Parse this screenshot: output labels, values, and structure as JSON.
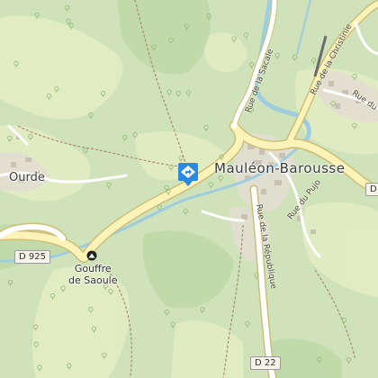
{
  "map": {
    "places": {
      "town": "Mauléon-Barousse",
      "village": "Ourde"
    },
    "poi": {
      "cave_name_line1": "Gouffre",
      "cave_name_line2": "de Saoule"
    },
    "road_shields": {
      "left": "D 925",
      "bottom": "D 22",
      "right": "D"
    },
    "road_names": {
      "sacale": "Rue de la Sacale",
      "christinie": "Rue de la Christinie",
      "republique": "Rue de la République",
      "pujo": "Rue du Pujo",
      "du_top": "Rue du"
    },
    "colors": {
      "forest": "#cfe2b9",
      "meadow": "#e8efc4",
      "road_fill": "#fbf3b8",
      "road_casing": "#cdbf7a",
      "water": "#9ecde0",
      "urban": "#e3e0d6",
      "marker": "#2a8ae0"
    },
    "icons": {
      "marker": "directions-marker-icon",
      "cave": "cave-icon"
    }
  }
}
